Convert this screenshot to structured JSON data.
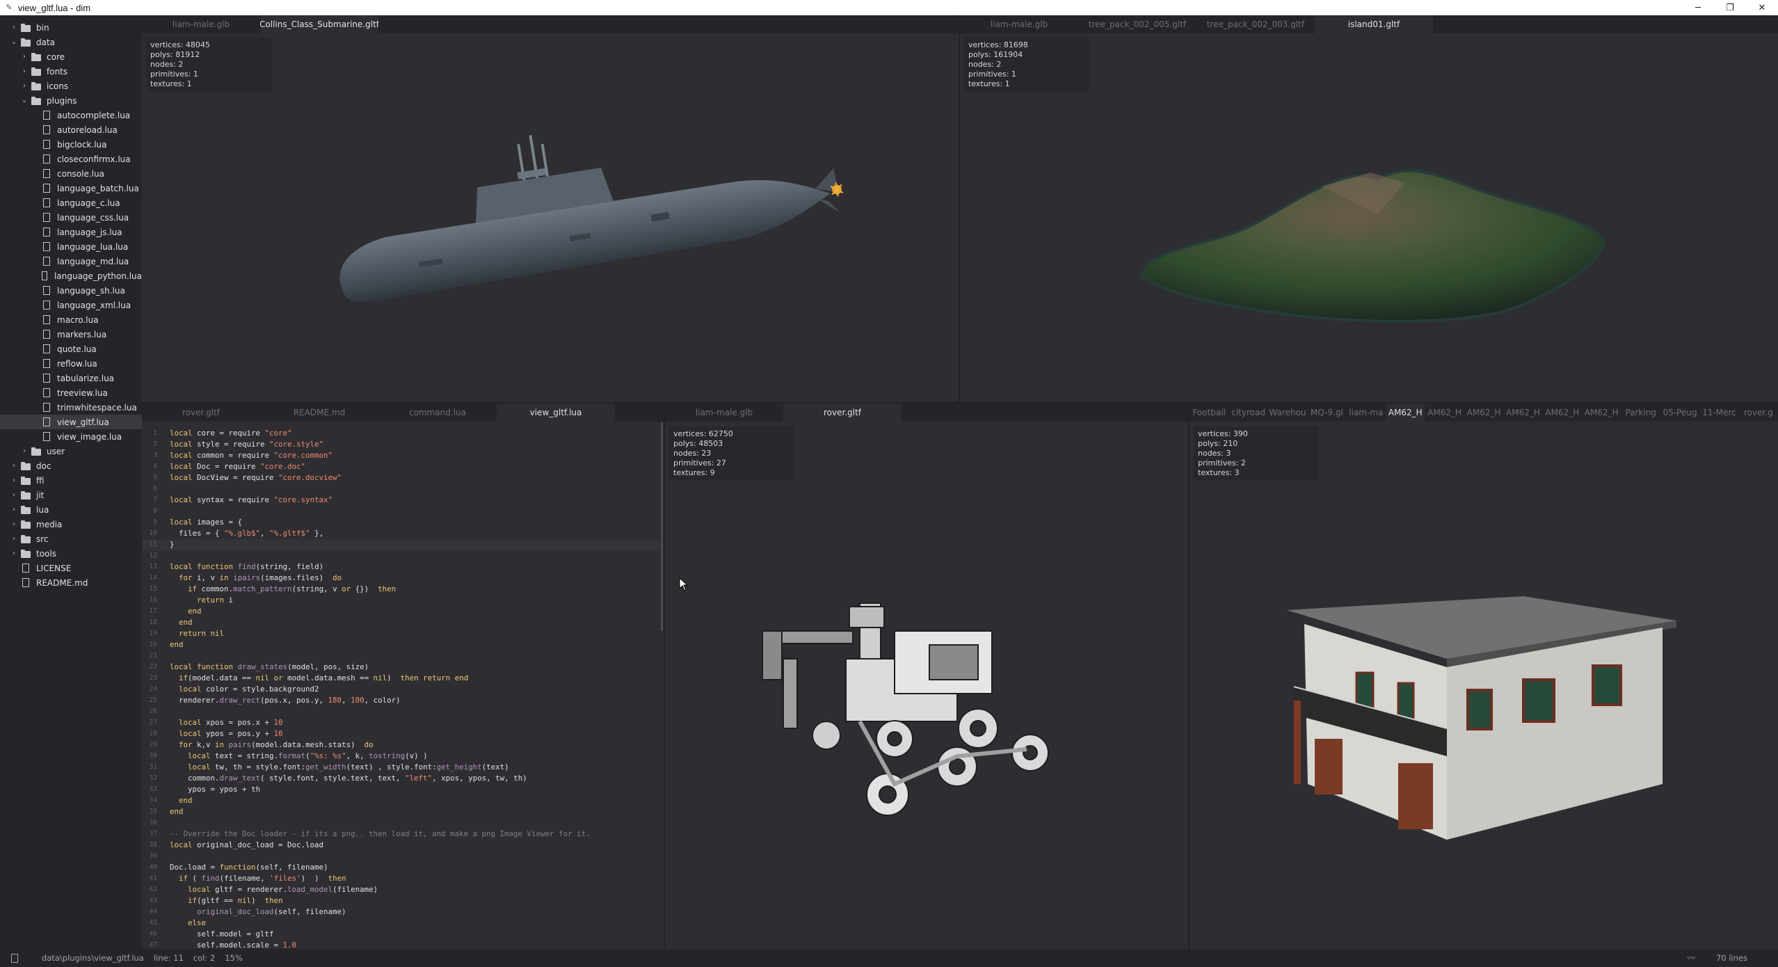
{
  "window": {
    "title": "view_gltf.lua - dim",
    "buttons": {
      "minimize": "─",
      "maximize": "❐",
      "close": "✕"
    }
  },
  "sidebar": {
    "rows": [
      {
        "label": "bin",
        "type": "folder",
        "expanded": false,
        "depth": 0
      },
      {
        "label": "data",
        "type": "folder",
        "expanded": true,
        "depth": 0
      },
      {
        "label": "core",
        "type": "folder",
        "expanded": false,
        "depth": 1
      },
      {
        "label": "fonts",
        "type": "folder",
        "expanded": false,
        "depth": 1
      },
      {
        "label": "icons",
        "type": "folder",
        "expanded": false,
        "depth": 1
      },
      {
        "label": "plugins",
        "type": "folder",
        "expanded": true,
        "depth": 1
      },
      {
        "label": "autocomplete.lua",
        "type": "file",
        "depth": 2
      },
      {
        "label": "autoreload.lua",
        "type": "file",
        "depth": 2
      },
      {
        "label": "bigclock.lua",
        "type": "file",
        "depth": 2
      },
      {
        "label": "closeconfirmx.lua",
        "type": "file",
        "depth": 2
      },
      {
        "label": "console.lua",
        "type": "file",
        "depth": 2
      },
      {
        "label": "language_batch.lua",
        "type": "file",
        "depth": 2
      },
      {
        "label": "language_c.lua",
        "type": "file",
        "depth": 2
      },
      {
        "label": "language_css.lua",
        "type": "file",
        "depth": 2
      },
      {
        "label": "language_js.lua",
        "type": "file",
        "depth": 2
      },
      {
        "label": "language_lua.lua",
        "type": "file",
        "depth": 2
      },
      {
        "label": "language_md.lua",
        "type": "file",
        "depth": 2
      },
      {
        "label": "language_python.lua",
        "type": "file",
        "depth": 2
      },
      {
        "label": "language_sh.lua",
        "type": "file",
        "depth": 2
      },
      {
        "label": "language_xml.lua",
        "type": "file",
        "depth": 2
      },
      {
        "label": "macro.lua",
        "type": "file",
        "depth": 2
      },
      {
        "label": "markers.lua",
        "type": "file",
        "depth": 2
      },
      {
        "label": "quote.lua",
        "type": "file",
        "depth": 2
      },
      {
        "label": "reflow.lua",
        "type": "file",
        "depth": 2
      },
      {
        "label": "tabularize.lua",
        "type": "file",
        "depth": 2
      },
      {
        "label": "treeview.lua",
        "type": "file",
        "depth": 2
      },
      {
        "label": "trimwhitespace.lua",
        "type": "file",
        "depth": 2
      },
      {
        "label": "view_gltf.lua",
        "type": "file",
        "depth": 2,
        "active": true
      },
      {
        "label": "view_image.lua",
        "type": "file",
        "depth": 2
      },
      {
        "label": "user",
        "type": "folder",
        "expanded": false,
        "depth": 1
      },
      {
        "label": "doc",
        "type": "folder",
        "expanded": false,
        "depth": 0
      },
      {
        "label": "ffi",
        "type": "folder",
        "expanded": false,
        "depth": 0
      },
      {
        "label": "jit",
        "type": "folder",
        "expanded": false,
        "depth": 0
      },
      {
        "label": "lua",
        "type": "folder",
        "expanded": false,
        "depth": 0
      },
      {
        "label": "media",
        "type": "folder",
        "expanded": false,
        "depth": 0
      },
      {
        "label": "src",
        "type": "folder",
        "expanded": false,
        "depth": 0
      },
      {
        "label": "tools",
        "type": "folder",
        "expanded": false,
        "depth": 0
      },
      {
        "label": "LICENSE",
        "type": "file",
        "depth": 0
      },
      {
        "label": "README.md",
        "type": "file",
        "depth": 0
      }
    ]
  },
  "panes": {
    "top_left": {
      "tabs": [
        {
          "label": "liam-male.glb"
        },
        {
          "label": "Collins_Class_Submarine.gltf",
          "active": true
        }
      ],
      "stats": [
        "vertices: 48045",
        "polys: 81912",
        "nodes: 2",
        "primitives: 1",
        "textures: 1"
      ]
    },
    "top_right": {
      "tabs": [
        {
          "label": "liam-male.glb"
        },
        {
          "label": "tree_pack_002_005.gltf"
        },
        {
          "label": "tree_pack_002_003.gltf"
        },
        {
          "label": "island01.gltf",
          "active": true
        }
      ],
      "stats": [
        "vertices: 81698",
        "polys: 161904",
        "nodes: 2",
        "primitives: 1",
        "textures: 1"
      ]
    },
    "bottom_left": {
      "tabs": [
        {
          "label": "rover.gltf"
        },
        {
          "label": "README.md"
        },
        {
          "label": "command.lua"
        },
        {
          "label": "view_gltf.lua",
          "active": true
        }
      ]
    },
    "bottom_middle": {
      "tabs": [
        {
          "label": "liam-male.glb"
        },
        {
          "label": "rover.gltf",
          "active": true
        }
      ],
      "stats": [
        "vertices: 62750",
        "polys: 48503",
        "nodes: 23",
        "primitives: 27",
        "textures: 9"
      ]
    },
    "bottom_right": {
      "tabs": [
        {
          "label": "Football"
        },
        {
          "label": "cityroad"
        },
        {
          "label": "Warehou"
        },
        {
          "label": "MQ-9.gl"
        },
        {
          "label": "liam-ma"
        },
        {
          "label": "AM62_H",
          "active": true
        },
        {
          "label": "AM62_H"
        },
        {
          "label": "AM62_H"
        },
        {
          "label": "AM62_H"
        },
        {
          "label": "AM62_H"
        },
        {
          "label": "AM62_H"
        },
        {
          "label": "Parking"
        },
        {
          "label": "05-Peug"
        },
        {
          "label": "11-Merc"
        },
        {
          "label": "rover.g"
        }
      ],
      "stats": [
        "vertices: 390",
        "polys: 210",
        "nodes: 3",
        "primitives: 2",
        "textures: 3"
      ]
    }
  },
  "editor": {
    "current_line": 11,
    "lines": [
      "local core = require \"core\"",
      "local style = require \"core.style\"",
      "local common = require \"core.common\"",
      "local Doc = require \"core.doc\"",
      "local DocView = require \"core.docview\"",
      "",
      "local syntax = require \"core.syntax\"",
      "",
      "local images = {",
      "  files = { \"%.glb$\", \"%.gltf$\" },",
      "}",
      "",
      "local function find(string, field)",
      "  for i, v in ipairs(images.files)  do",
      "    if common.match_pattern(string, v or {})  then",
      "      return i",
      "    end",
      "  end",
      "  return nil",
      "end",
      "",
      "local function draw_states(model, pos, size)",
      "  if(model.data == nil or model.data.mesh == nil)  then return end",
      "  local color = style.background2",
      "  renderer.draw_rect(pos.x, pos.y, 180, 100, color)",
      "",
      "  local xpos = pos.x + 10",
      "  local ypos = pos.y + 10",
      "  for k,v in pairs(model.data.mesh.stats)  do",
      "    local text = string.format(\"%s: %s\", k, tostring(v) )",
      "    local tw, th = style.font:get_width(text) , style.font:get_height(text)",
      "    common.draw_text( style.font, style.text, text, \"left\", xpos, ypos, tw, th)",
      "    ypos = ypos + th",
      "  end",
      "end",
      "",
      "-- Override the Doc loader - if its a png.. then load it, and make a png Image Viewer for it.",
      "local original_doc_load = Doc.load",
      "",
      "Doc.load = function(self, filename)",
      "  if ( find(filename, 'files')  )  then",
      "    local gltf = renderer.load_model(filename)",
      "    if(gltf == nil)  then",
      "      original_doc_load(self, filename)",
      "    else",
      "      self.model = gltf",
      "      self.model.scale = 1.0"
    ]
  },
  "statusbar": {
    "file_icon": "file-icon",
    "path": "data\\plugins\\view_gltf.lua",
    "line": "line: 11",
    "col": "col: 2",
    "percent": "15%",
    "lines_count": "70 lines"
  },
  "colors": {
    "background": "#2e2e32",
    "sidebar": "#252529",
    "text": "#e1e1e6",
    "dim": "#6e6e76",
    "keyword": "#f0c674",
    "string": "#f08a6c",
    "function": "#b294bb"
  }
}
